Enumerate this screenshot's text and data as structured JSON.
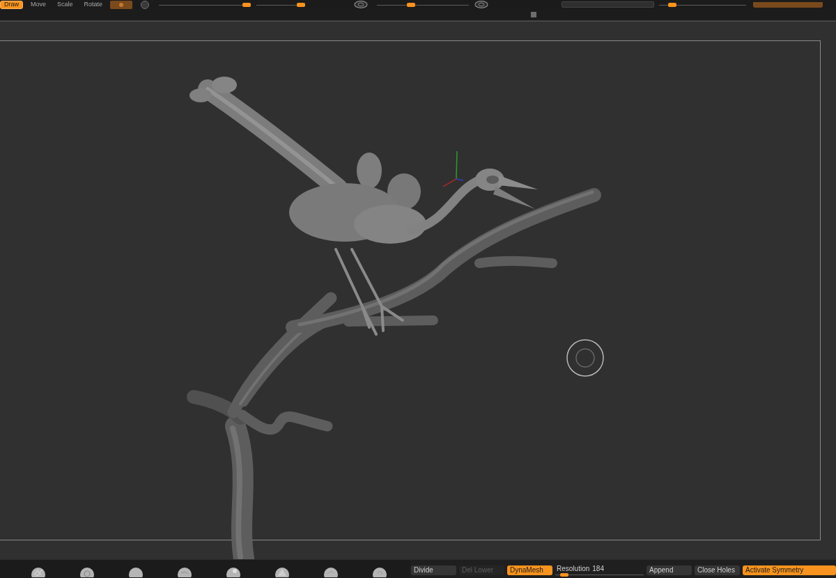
{
  "toolbar": {
    "modes": [
      {
        "label": "Draw",
        "selected": true
      },
      {
        "label": "Move",
        "selected": false
      },
      {
        "label": "Scale",
        "selected": false
      },
      {
        "label": "Rotate",
        "selected": false
      }
    ],
    "sliders": [
      {
        "level": 0.97
      },
      {
        "level": 0.95
      },
      {
        "level": 0.37
      },
      {
        "level": 0.15
      }
    ]
  },
  "geometry_panel": {
    "items": [
      {
        "kind": "button",
        "label": "Divide",
        "on": false,
        "disabled": false
      },
      {
        "kind": "button",
        "label": "Del Lower",
        "on": false,
        "disabled": true
      },
      {
        "kind": "button",
        "label": "DynaMesh",
        "on": true,
        "disabled": false
      },
      {
        "kind": "slider",
        "label": "Resolution",
        "value": "184",
        "level": 0.07
      },
      {
        "kind": "button",
        "label": "Append",
        "on": false,
        "disabled": false
      },
      {
        "kind": "button",
        "label": "Close Holes",
        "on": false,
        "disabled": false
      },
      {
        "kind": "button",
        "label": "Activate Symmetry",
        "on": true,
        "disabled": false
      }
    ]
  }
}
